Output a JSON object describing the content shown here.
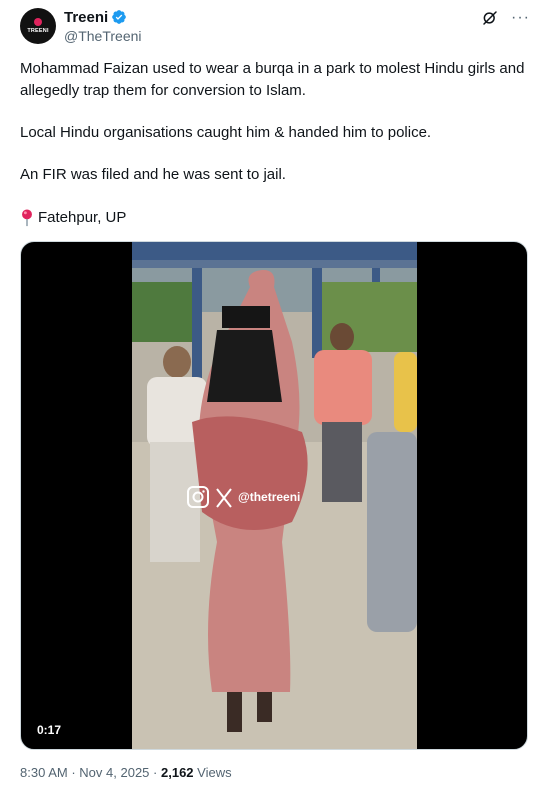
{
  "author": {
    "display_name": "Treeni",
    "handle": "@TheTreeni",
    "avatar_text": "TREENI"
  },
  "header": {
    "grok_icon": "grok-icon",
    "more_label": "···"
  },
  "tweet": {
    "paragraph1": "Mohammad Faizan used to wear a burqa in a park to molest Hindu girls and allegedly trap them for conversion to Islam.",
    "paragraph2": "Local Hindu organisations caught him & handed him to police.",
    "paragraph3": "An FIR was filed and he was sent to jail.",
    "location": "Fatehpur, UP"
  },
  "media": {
    "duration": "0:17",
    "watermark": "@thetreeni"
  },
  "footer": {
    "time": "8:30 AM",
    "separator": "·",
    "date": "Nov 4, 2025",
    "views_count": "2,162",
    "views_label": "Views"
  },
  "colors": {
    "verified": "#1d9bf0",
    "secondary_text": "#536471",
    "pin": "#e0245e"
  }
}
